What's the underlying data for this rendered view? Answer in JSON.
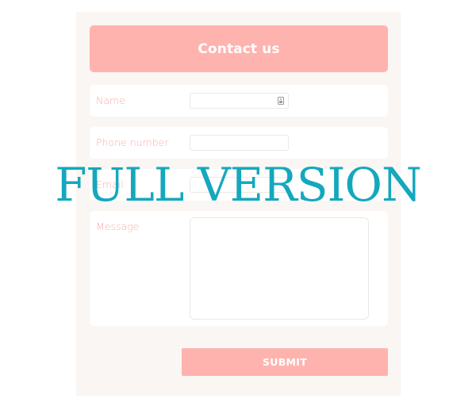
{
  "form": {
    "title": "Contact us",
    "fields": {
      "name": {
        "label": "Name",
        "value": "",
        "placeholder": ""
      },
      "phone": {
        "label": "Phone number",
        "value": "",
        "placeholder": ""
      },
      "email": {
        "label": "Email",
        "value": "",
        "placeholder": ""
      },
      "message": {
        "label": "Message",
        "value": "",
        "placeholder": ""
      }
    },
    "submit_label": "SUBMIT"
  },
  "watermark": {
    "text": "FULL VERSION"
  },
  "icons": {
    "name_field_icon": "contact-card-icon"
  },
  "colors": {
    "accent": "#ffb3ae",
    "label": "#f9aea9",
    "card_background": "#f9f6f3",
    "watermark": "#14a8bd"
  }
}
